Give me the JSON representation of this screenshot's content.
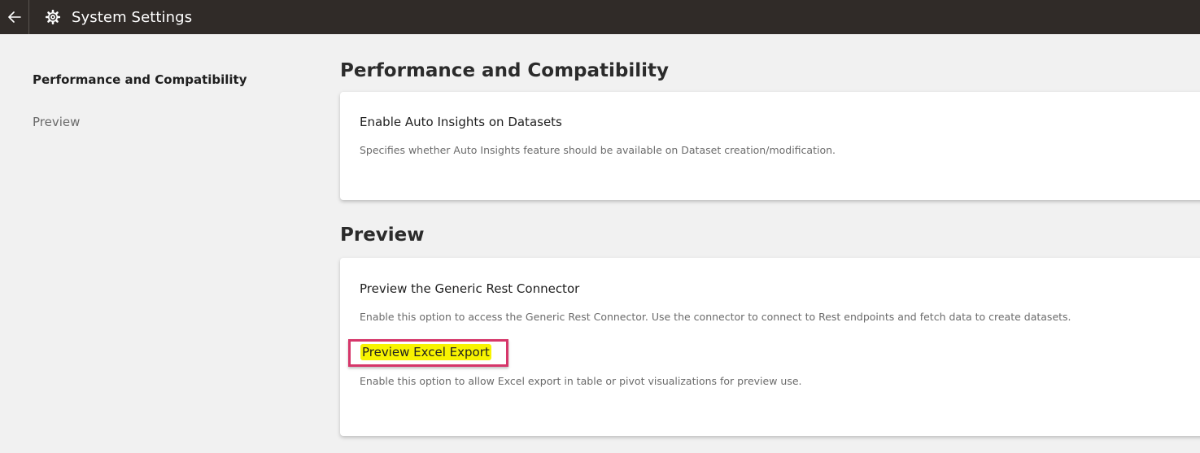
{
  "topbar": {
    "back_icon": "arrow-left-icon",
    "settings_icon": "gear-icon",
    "title": "System Settings"
  },
  "sidebar": {
    "items": [
      {
        "label": "Performance and Compatibility",
        "active": true
      },
      {
        "label": "Preview",
        "active": false
      }
    ]
  },
  "sections": [
    {
      "title": "Performance and Compatibility",
      "settings": [
        {
          "title": "Enable Auto Insights on Datasets",
          "description": "Specifies whether Auto Insights feature should be available on Dataset creation/modification."
        }
      ]
    },
    {
      "title": "Preview",
      "settings": [
        {
          "title": "Preview the Generic Rest Connector",
          "description": "Enable this option to access the Generic Rest Connector. Use the connector to connect to Rest endpoints and fetch data to create datasets."
        },
        {
          "title": "Preview Excel Export",
          "description": "Enable this option to allow Excel export in table or pivot visualizations for preview use.",
          "highlighted": true
        }
      ]
    }
  ],
  "colors": {
    "topbar_bg": "#302b28",
    "page_bg": "#f1f1f1",
    "highlight_fill": "#f8f300",
    "highlight_border": "#d6366a"
  }
}
